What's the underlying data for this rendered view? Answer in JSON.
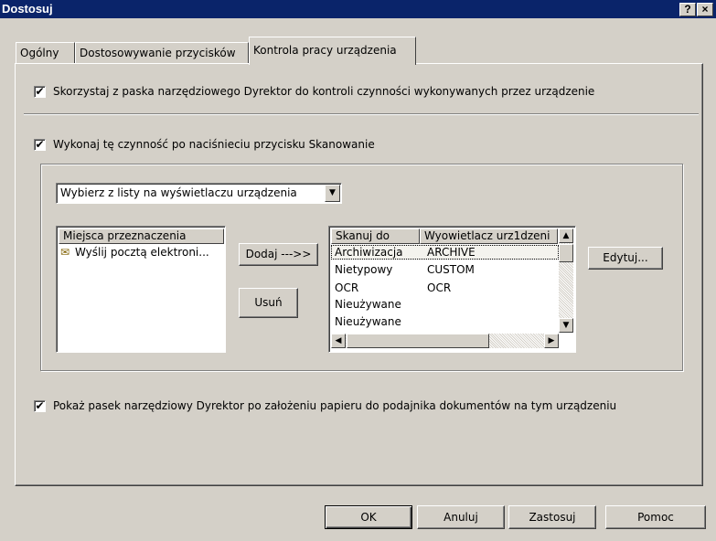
{
  "window": {
    "title": "Dostosuj",
    "help_button": "?",
    "close_button": "×"
  },
  "tabs": [
    {
      "label": "Ogólny"
    },
    {
      "label": "Dostosowywanie przycisków"
    },
    {
      "label": "Kontrola pracy urządzenia"
    }
  ],
  "checkboxes": {
    "use_toolbar": {
      "label": "Skorzystaj z paska narzędziowego Dyrektor do kontroli czynności wykonywanych przez urządzenie",
      "checked": true
    },
    "run_action": {
      "label": "Wykonaj tę czynność po naciśnieciu przycisku Skanowanie",
      "checked": true
    },
    "show_toolbar": {
      "label": "Pokaż pasek narzędziowy Dyrektor po założeniu papieru do podajnika dokumentów na tym urządzeniu",
      "checked": true
    }
  },
  "mode_select": {
    "value": "Wybierz z listy na wyświetlaczu urządzenia"
  },
  "destinations": {
    "header": "Miejsca przeznaczenia",
    "items": [
      {
        "label": "Wyślij pocztą elektroni..."
      }
    ]
  },
  "buttons": {
    "add": "Dodaj --->>",
    "remove": "Usuń",
    "edit": "Edytuj...",
    "ok": "OK",
    "cancel": "Anuluj",
    "apply": "Zastosuj",
    "help": "Pomoc"
  },
  "scan_list": {
    "headers": [
      "Skanuj do",
      "Wyowietlacz urz1dzeni"
    ],
    "rows": [
      {
        "target": "Archiwizacja",
        "display": "ARCHIVE"
      },
      {
        "target": "Nietypowy",
        "display": "CUSTOM"
      },
      {
        "target": "OCR",
        "display": "OCR"
      },
      {
        "target": "Nieużywane",
        "display": ""
      },
      {
        "target": "Nieużywane",
        "display": ""
      }
    ]
  }
}
